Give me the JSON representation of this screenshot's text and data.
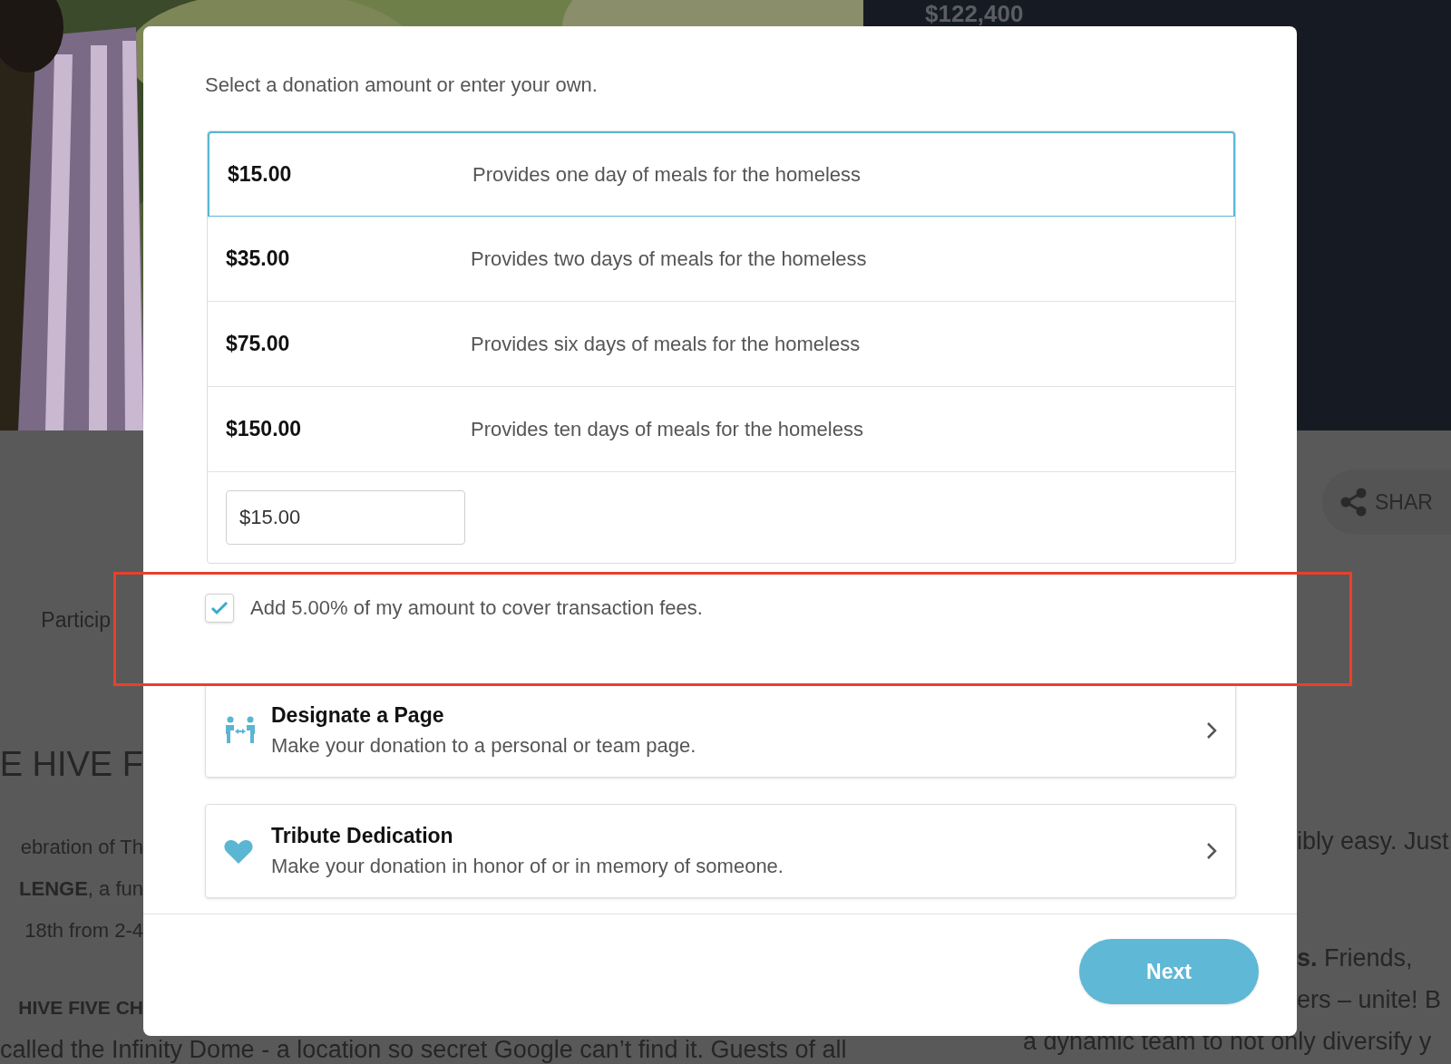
{
  "background": {
    "total": "$122,400",
    "share_button": "SHAR",
    "tab": "Particip",
    "heading": "E HIVE F",
    "left_lines": [
      "ebration of Th",
      "**LENGE**, a fun",
      "18th from 2-4"
    ],
    "left_subheading": "HIVE FIVE CH",
    "bottom_line_left": "called the Infinity Dome - a location so secret Google can’t find it. Guests of all",
    "right_lines": [
      "ibly easy. Just",
      "**s.** Friends,",
      "ers – unite! B"
    ],
    "bottom_line_right": "a dynamic team to not only diversify y"
  },
  "dialog": {
    "prompt": "Select a donation amount or enter your own.",
    "amounts": [
      {
        "amount": "$15.00",
        "description": "Provides one day of meals for the homeless",
        "selected": true
      },
      {
        "amount": "$35.00",
        "description": "Provides two days of meals for the homeless",
        "selected": false
      },
      {
        "amount": "$75.00",
        "description": "Provides six days of meals for the homeless",
        "selected": false
      },
      {
        "amount": "$150.00",
        "description": "Provides ten days of meals for the homeless",
        "selected": false
      }
    ],
    "custom_amount": {
      "value": "$15.00"
    },
    "cover_fees": {
      "label": "Add 5.00% of my amount to cover transaction fees.",
      "checked": true
    },
    "options": [
      {
        "kind": "designate",
        "title": "Designate a Page",
        "description": "Make your donation to a personal or team page."
      },
      {
        "kind": "tribute",
        "title": "Tribute Dedication",
        "description": "Make your donation in honor of or in memory of someone."
      }
    ],
    "next_button": "Next"
  },
  "highlight_frame": true
}
